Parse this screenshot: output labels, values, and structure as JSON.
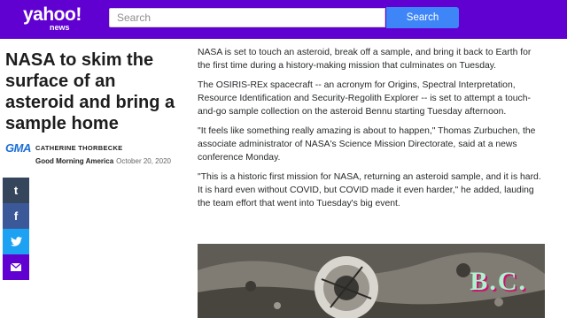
{
  "header": {
    "logo_brand": "yahoo!",
    "logo_sub": "news",
    "search_placeholder": "Search",
    "search_button": "Search",
    "bg_color": "#6001d2",
    "button_color": "#3e86f7"
  },
  "article": {
    "headline": "NASA to skim the surface of an asteroid and bring a sample home",
    "source_logo": "GMA",
    "author": "CATHERINE THORBECKE",
    "publication": "Good Morning America",
    "date": "October 20, 2020",
    "paragraphs": [
      "NASA is set to touch an asteroid, break off a sample, and bring it back to Earth for the first time during a history-making mission that culminates on Tuesday.",
      "The OSIRIS-REx spacecraft -- an acronym for Origins, Spectral Interpretation, Resource Identification and Security-Regolith Explorer -- is set to attempt a touch-and-go sample collection on the asteroid Bennu starting Tuesday afternoon.",
      "\"It feels like something really amazing is about to happen,\" Thomas Zurbuchen, the associate administrator of NASA's Science Mission Directorate, said at a news conference Monday.",
      "\"This is a historic first mission for NASA, returning an asteroid sample, and it is hard. It is hard even without COVID, but COVID made it even harder,\" he added, lauding the team effort that went into Tuesday's big event."
    ],
    "image_watermark": "B.C."
  },
  "share": {
    "tumblr": "t",
    "facebook": "f",
    "twitter": "twitter-bird-icon",
    "mail": "mail-icon"
  }
}
